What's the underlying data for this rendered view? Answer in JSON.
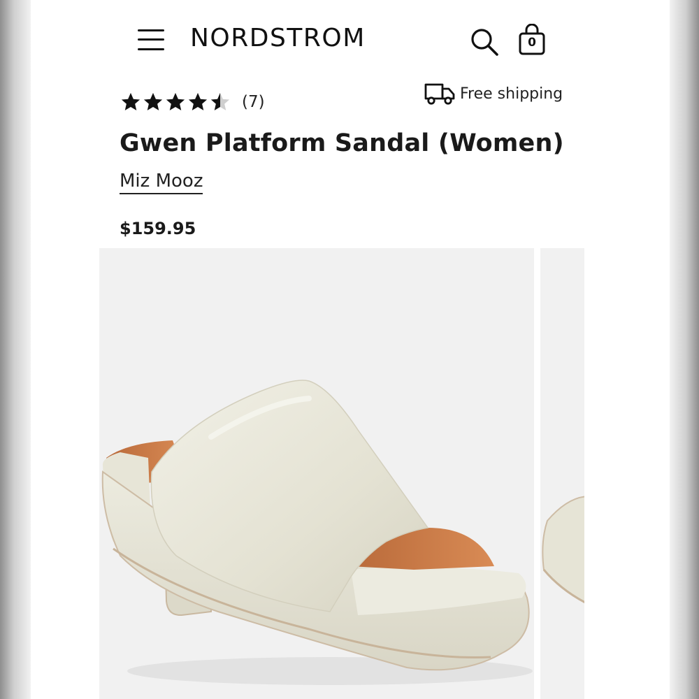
{
  "header": {
    "menu_icon": "hamburger-menu-icon",
    "logo": "NORDSTROM",
    "search_icon": "search-icon",
    "bag_icon": "shopping-bag-icon",
    "bag_count": "0"
  },
  "product": {
    "rating": 4.5,
    "rating_max": 5,
    "review_count": "(7)",
    "shipping_label": "Free shipping",
    "title": "Gwen Platform Sandal (Women)",
    "brand": "Miz Mooz",
    "price": "$159.95"
  },
  "gallery": {
    "slides": [
      {
        "subject": "ivory leather platform mule sandal"
      },
      {
        "subject": "partial view of next sandal image"
      }
    ]
  },
  "colors": {
    "text": "#111111",
    "shoe_leather": "#e6e4d6",
    "footbed": "#c77c4a",
    "image_bg": "#f1f1f1"
  }
}
